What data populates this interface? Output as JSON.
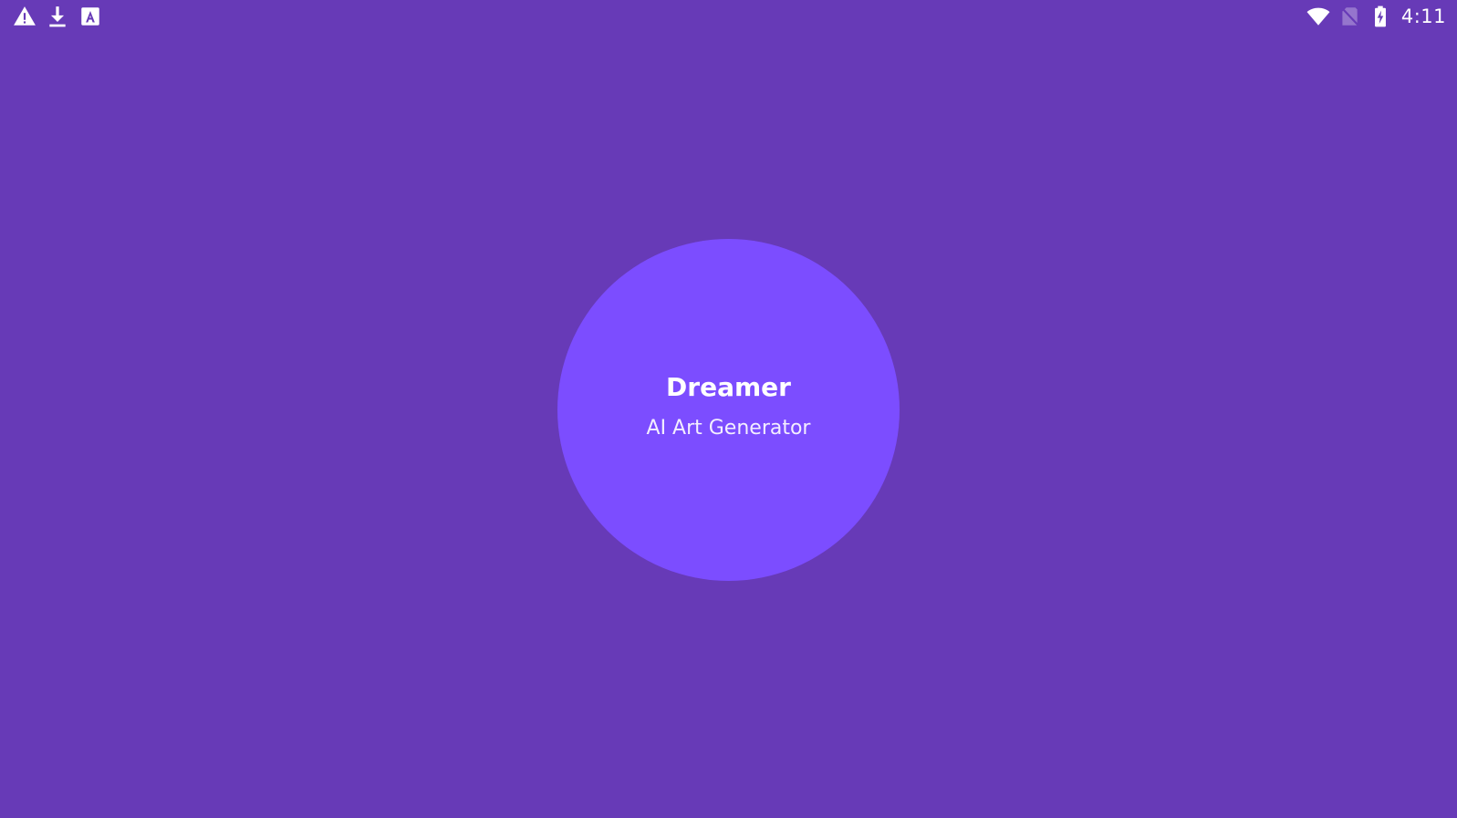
{
  "status_bar": {
    "left_icons": [
      "warning-icon",
      "download-icon",
      "text-a-icon"
    ],
    "right_icons": [
      "wifi-icon",
      "no-sim-icon",
      "battery-charging-icon"
    ],
    "time": "4:11"
  },
  "splash": {
    "title": "Dreamer",
    "subtitle": "AI Art Generator"
  },
  "colors": {
    "background": "#673AB7",
    "circle": "#7C4DFF",
    "text": "#FFFFFF"
  }
}
